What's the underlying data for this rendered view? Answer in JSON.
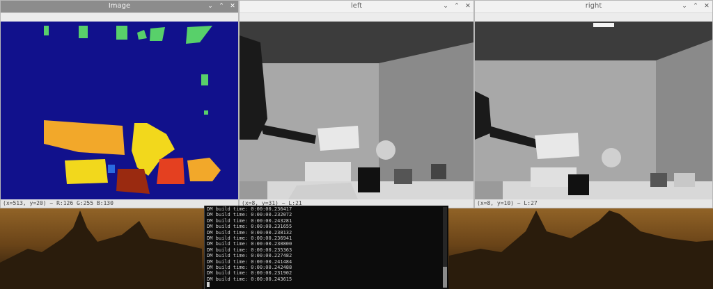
{
  "windows": {
    "image": {
      "title": "Image",
      "status": "(x=513, y=20) ~ R:126 G:255 B:130"
    },
    "left": {
      "title": "left",
      "status": "(x=8, y=31) ~ L:21"
    },
    "right": {
      "title": "right",
      "status": "(x=8, y=10) ~ L:27"
    }
  },
  "window_controls": {
    "minimize": "⌄",
    "maximize": "⌃",
    "close": "✕"
  },
  "terminal": {
    "lines": [
      "DM build time: 0:00:00.236417",
      "DM build time: 0:00:00.232072",
      "DM build time: 0:00:00.243281",
      "DM build time: 0:00:00.231655",
      "DM build time: 0:00:00.238132",
      "DM build time: 0:00:00.236941",
      "DM build time: 0:00:00.230800",
      "DM build time: 0:00:00.235363",
      "DM build time: 0:00:00.227482",
      "DM build time: 0:00:00.241484",
      "DM build time: 0:00:00.242488",
      "DM build time: 0:00:00.231902",
      "DM build time: 0:00:00.243615"
    ]
  },
  "colors": {
    "depth_background": "#11118c",
    "depth_near": "#d03a1c",
    "depth_mid": "#f2d81c",
    "depth_far": "#58d06a"
  },
  "icons": [
    "minimize-icon",
    "maximize-icon",
    "close-icon"
  ]
}
